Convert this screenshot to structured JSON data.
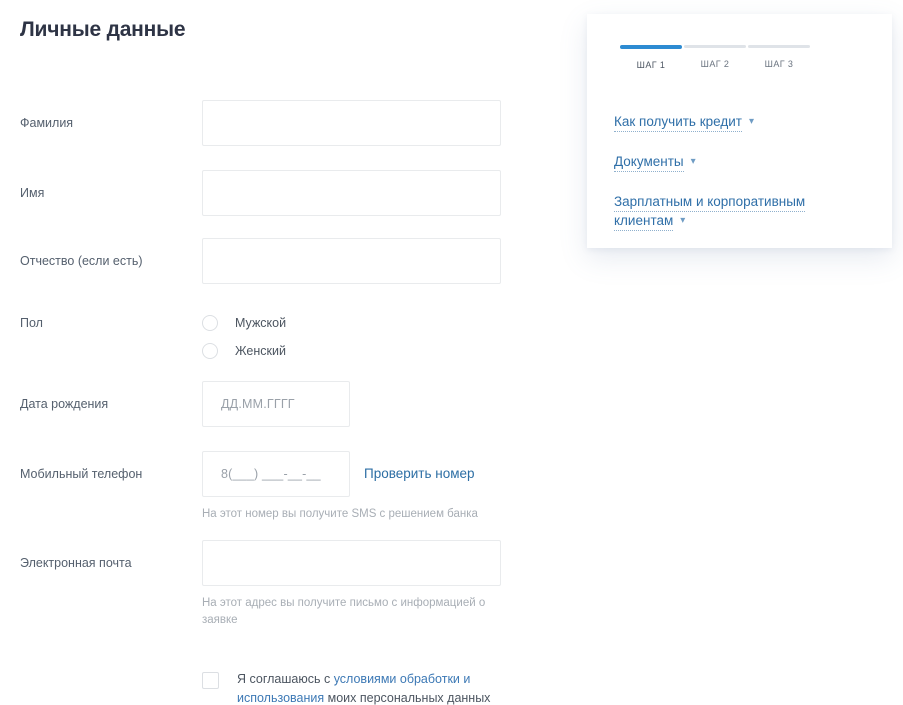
{
  "page": {
    "title": "Личные данные"
  },
  "form": {
    "fields": [
      {
        "label": "Фамилия",
        "placeholder": "",
        "value": ""
      },
      {
        "label": "Имя",
        "placeholder": "",
        "value": ""
      },
      {
        "label": "Отчество (если есть)",
        "placeholder": "",
        "value": ""
      }
    ],
    "gender": {
      "label": "Пол",
      "options": [
        {
          "label": "Мужской",
          "selected": false
        },
        {
          "label": "Женский",
          "selected": false
        }
      ]
    },
    "birth_date": {
      "label": "Дата рождения",
      "placeholder": "ДД.ММ.ГГГГ",
      "value": ""
    },
    "phone": {
      "label": "Мобильный телефон",
      "placeholder": "8(___) ___-__-__",
      "value": "",
      "check_link": "Проверить номер",
      "hint": "На этот номер вы получите SMS с решением банка"
    },
    "email": {
      "label": "Электронная почта",
      "placeholder": "",
      "value": "",
      "hint": "На этот адрес вы получите письмо с информацией о заявке"
    },
    "consent": {
      "checked": false,
      "text_before": "Я соглашаюсь с ",
      "link_text": "условиями обработки и использования",
      "text_after": " моих персональных данных"
    }
  },
  "side_card": {
    "steps": [
      {
        "label": "ШАГ 1",
        "active": true
      },
      {
        "label": "ШАГ 2",
        "active": false
      },
      {
        "label": "ШАГ 3",
        "active": false
      }
    ],
    "links": [
      {
        "label": "Как получить кредит"
      },
      {
        "label": "Документы"
      },
      {
        "label": "Зарплатным и корпоративным клиентам"
      }
    ],
    "caret_icon": "chevron-down-icon"
  },
  "colors": {
    "accent_blue": "#2d8bd2",
    "link_blue": "#2f6fa8",
    "title": "#2e3445",
    "label": "#55606e",
    "hint": "#a8aeb5",
    "border": "#e9ebed"
  }
}
